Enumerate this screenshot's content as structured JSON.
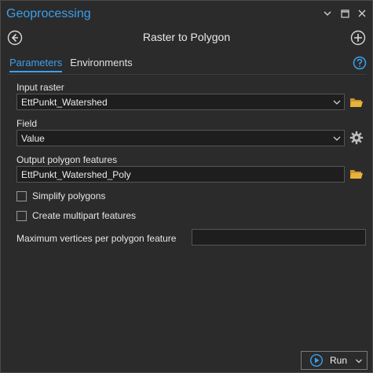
{
  "window": {
    "title": "Geoprocessing"
  },
  "header": {
    "tool_title": "Raster to Polygon"
  },
  "tabs": [
    {
      "label": "Parameters",
      "active": true
    },
    {
      "label": "Environments",
      "active": false
    }
  ],
  "parameters": {
    "input_raster": {
      "label": "Input raster",
      "value": "EttPunkt_Watershed"
    },
    "field": {
      "label": "Field",
      "value": "Value"
    },
    "output": {
      "label": "Output polygon features",
      "value": "EttPunkt_Watershed_Poly"
    },
    "simplify": {
      "label": "Simplify polygons",
      "checked": false
    },
    "multipart": {
      "label": "Create multipart features",
      "checked": false
    },
    "max_vertices": {
      "label": "Maximum vertices per polygon feature",
      "value": ""
    }
  },
  "run": {
    "label": "Run"
  },
  "colors": {
    "accent": "#3aa0ef",
    "background": "#2b2b2b",
    "field_bg": "#1e1e1e",
    "folder": "#e8b33a"
  },
  "icons": [
    "chevron-down-icon",
    "restore-window-icon",
    "close-icon",
    "back-arrow-icon",
    "add-icon",
    "help-icon",
    "folder-icon",
    "gear-icon",
    "run-play-icon"
  ]
}
